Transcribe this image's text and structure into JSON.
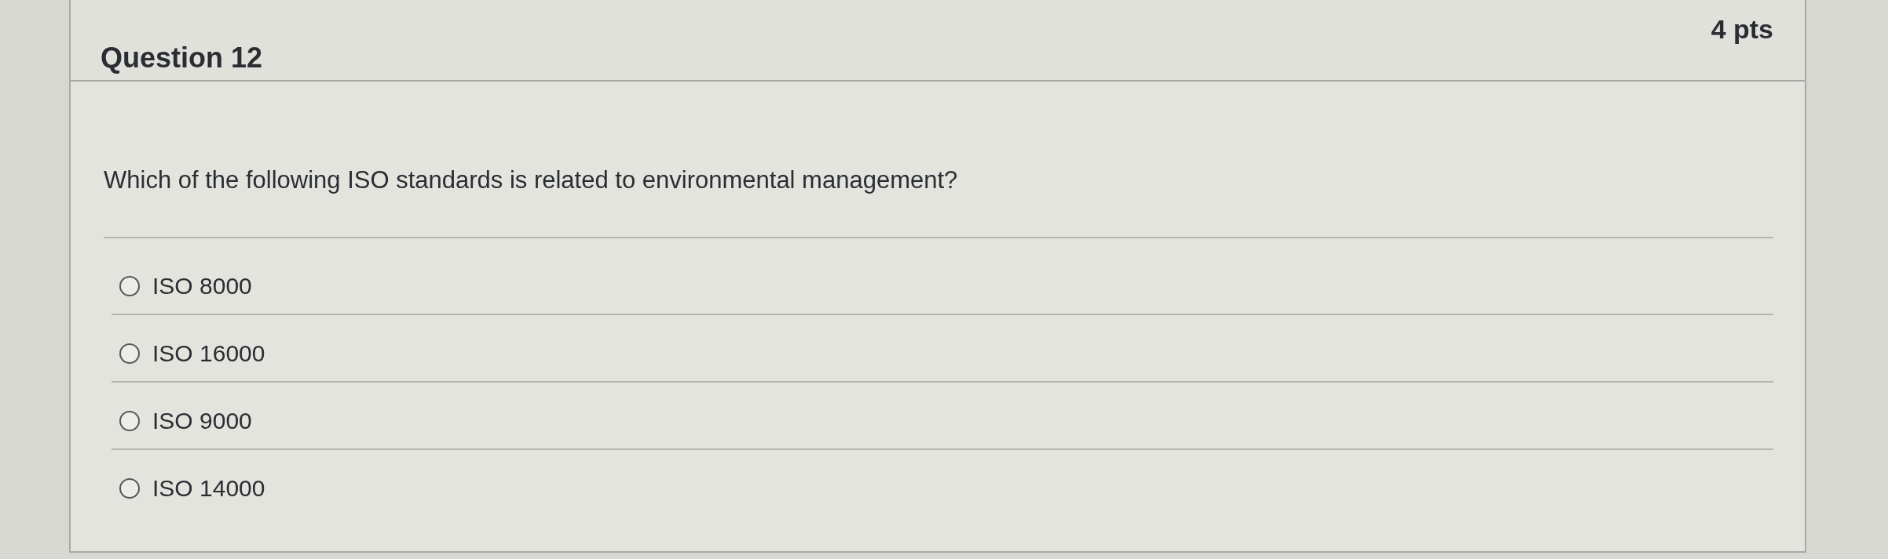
{
  "question": {
    "title": "Question 12",
    "points": "4 pts",
    "text": "Which of the following ISO standards is related to environmental management?",
    "options": [
      {
        "label": "ISO 8000",
        "selected": false
      },
      {
        "label": "ISO 16000",
        "selected": false
      },
      {
        "label": "ISO 9000",
        "selected": false
      },
      {
        "label": "ISO 14000",
        "selected": false
      }
    ]
  }
}
